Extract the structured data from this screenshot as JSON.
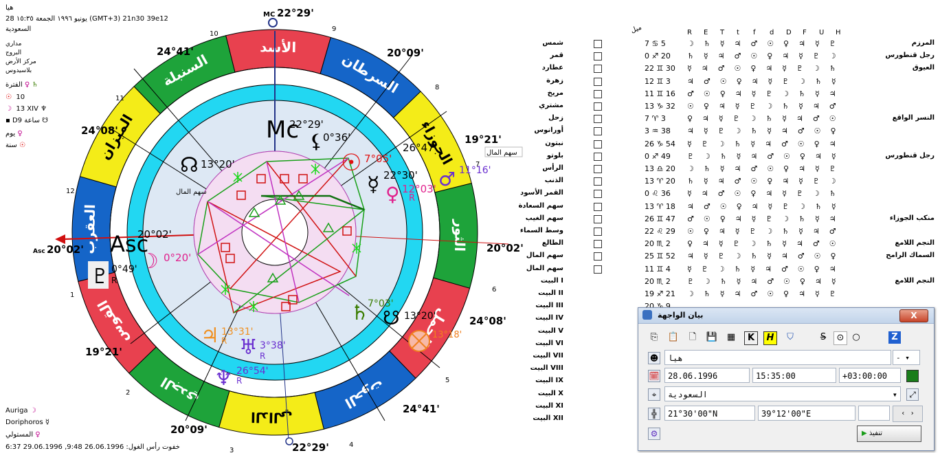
{
  "top_left": {
    "name": "هيا",
    "line2": "28 يونيو ١٩٩٦ الجمعة ١٥:٣٥ (GMT+3) 21n30 39e12",
    "country": "السعودية",
    "opts": [
      "مداري",
      "البروج",
      "مركز الأرض",
      "بلاسيدوس"
    ],
    "period_label": "الفترة",
    "val10": "10",
    "val13": "13 XIV",
    "val_d9": "D9 ساعة",
    "day": "يوم",
    "year": "سنة"
  },
  "bottom_left": {
    "auriga": "Auriga",
    "doriphoros": "Doriphoros",
    "mustawli": "المستولي",
    "dates": "خفوت رأس الغول: 26.06.1996  9:48,  29.06.1996  6:37"
  },
  "wheel": {
    "mc_deg": "22°29'",
    "ic_deg": "22°29'",
    "asc_deg": "20°02'",
    "dsc_deg": "20°02'",
    "cusp_2409": "24°41'",
    "cusp_2009": "20°09'",
    "cusp_2408": "24°08'",
    "cusp_1921": "19°21'",
    "cusp_2408b": "24°08'",
    "cusp_2441b": "24°41'",
    "cusp_1921b": "19°21'",
    "cusp_2009b": "20°09'",
    "signs": [
      "الأسد",
      "السرطان",
      "الجوزاء",
      "الثور",
      "الحمل",
      "الحوت",
      "الدالي",
      "الجدي",
      "القوس",
      "العقرب",
      "الميزان",
      "السنبلة"
    ],
    "planet_labels": {
      "mc": "22°29'",
      "moon_dark": "0°36'",
      "node": "13°20'",
      "sun": "7°05'",
      "mercury": "22°30'",
      "partfort": "26°47'",
      "venus": "12°03'",
      "mars": "11°16'",
      "asc": "20°02'",
      "pluto": "0°49'",
      "moon": "0°20'",
      "jupiter": "13°31'",
      "uranus": "3°38'",
      "neptune": "26°54'",
      "saturn": "7°03'",
      "snode": "13°20'",
      "fortune": "13°18'"
    },
    "sahm1": "سهم المال",
    "sahm2": "سهم المال",
    "house_numbers": [
      "10",
      "9",
      "8",
      "7",
      "6",
      "5",
      "4",
      "3",
      "2",
      "1",
      "12",
      "11"
    ],
    "mc": "MC"
  },
  "table": {
    "mayl": "ميل",
    "headers": [
      "R",
      "E",
      "T",
      "t",
      "f",
      "d",
      "D",
      "F",
      "U",
      "H"
    ],
    "rows": [
      {
        "name": "شمس",
        "deg": "7",
        "sign": "♋",
        "min": "5"
      },
      {
        "name": "قمر",
        "deg": "0",
        "sign": "♐",
        "min": "20"
      },
      {
        "name": "عطارد",
        "deg": "22",
        "sign": "♊",
        "min": "30"
      },
      {
        "name": "زهرة",
        "deg": "12",
        "sign": "♊",
        "min": "3"
      },
      {
        "name": "مريخ",
        "deg": "11",
        "sign": "♊",
        "min": "16"
      },
      {
        "name": "مشتري",
        "deg": "13",
        "sign": "♑",
        "min": "32"
      },
      {
        "name": "زحل",
        "deg": "7",
        "sign": "♈",
        "min": "3"
      },
      {
        "name": "أورانوس",
        "deg": "3",
        "sign": "♒",
        "min": "38"
      },
      {
        "name": "نبتون",
        "deg": "26",
        "sign": "♑",
        "min": "54"
      },
      {
        "name": "بلوتو",
        "deg": "0",
        "sign": "♐",
        "min": "49"
      },
      {
        "name": "الرأس",
        "deg": "13",
        "sign": "♎",
        "min": "20"
      },
      {
        "name": "الذنب",
        "deg": "13",
        "sign": "♈",
        "min": "20"
      },
      {
        "name": "القمر الأسود",
        "deg": "0",
        "sign": "♌",
        "min": "36"
      },
      {
        "name": "سهم السعادة",
        "deg": "13",
        "sign": "♈",
        "min": "18"
      },
      {
        "name": "سهم الغيب",
        "deg": "26",
        "sign": "♊",
        "min": "47"
      },
      {
        "name": "وسط السماء",
        "deg": "22",
        "sign": "♌",
        "min": "29"
      },
      {
        "name": "الطالع",
        "deg": "20",
        "sign": "♏",
        "min": "2"
      },
      {
        "name": "سهم المال",
        "deg": "25",
        "sign": "♊",
        "min": "52"
      },
      {
        "name": "سهم المال",
        "deg": "11",
        "sign": "♊",
        "min": "4"
      },
      {
        "name": "البيت I",
        "deg": "20",
        "sign": "♏",
        "min": "2"
      },
      {
        "name": "البيت II",
        "deg": "19",
        "sign": "♐",
        "min": "21"
      },
      {
        "name": "البيت III",
        "deg": "20",
        "sign": "♑",
        "min": "9"
      },
      {
        "name": "البيت IV",
        "deg": "",
        "sign": "",
        "min": ""
      },
      {
        "name": "البيت V",
        "deg": "",
        "sign": "",
        "min": ""
      },
      {
        "name": "البيت VI",
        "deg": "",
        "sign": "",
        "min": ""
      },
      {
        "name": "البيت VII",
        "deg": "",
        "sign": "",
        "min": ""
      },
      {
        "name": "البيت VIII",
        "deg": "",
        "sign": "",
        "min": ""
      },
      {
        "name": "البيت IX",
        "deg": "",
        "sign": "",
        "min": ""
      },
      {
        "name": "البيت X",
        "deg": "",
        "sign": "",
        "min": ""
      },
      {
        "name": "البيت XI",
        "deg": "",
        "sign": "",
        "min": ""
      },
      {
        "name": "البيت XII",
        "deg": "",
        "sign": "",
        "min": ""
      }
    ],
    "stars": [
      {
        "text": "المرزم"
      },
      {
        "text": "رجل قنطورس"
      },
      {
        "text": "العيوق"
      },
      {
        "text": ""
      },
      {
        "text": ""
      },
      {
        "text": ""
      },
      {
        "text": "النسر الواقع"
      },
      {
        "text": ""
      },
      {
        "text": ""
      },
      {
        "text": "رجل قنطورس"
      },
      {
        "text": ""
      },
      {
        "text": ""
      },
      {
        "text": ""
      },
      {
        "text": ""
      },
      {
        "text": "منكب الجوزاء"
      },
      {
        "text": ""
      },
      {
        "text": "النجم اللامع"
      },
      {
        "text": "السماك الرامح"
      },
      {
        "text": ""
      },
      {
        "text": "النجم اللامع"
      }
    ]
  },
  "dialog": {
    "title": "بيان الواجهة",
    "close": "X",
    "name_value": "هيا",
    "date": "28.06.1996",
    "time": "15:35:00",
    "tz": "+03:00:00",
    "place": "السعودية",
    "lat": "21°30'00\"N",
    "lon": "39°12'00\"E",
    "exec": "تنفيذ",
    "dash": "-"
  }
}
